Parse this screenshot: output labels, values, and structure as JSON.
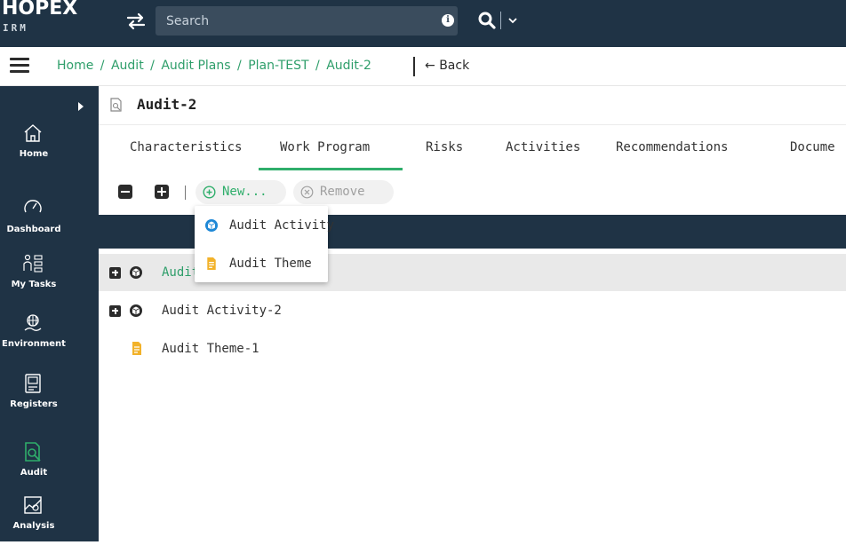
{
  "app": {
    "logo": "HOPEX",
    "logo_sub": "IRM"
  },
  "header": {
    "search_placeholder": "Search"
  },
  "breadcrumb": {
    "items": [
      "Home",
      "Audit",
      "Audit Plans",
      "Plan-TEST",
      "Audit-2"
    ],
    "separator": "/",
    "back_label": "Back"
  },
  "sidebar": {
    "items": [
      {
        "label": "Home",
        "icon": "home-icon"
      },
      {
        "label": "Dashboard",
        "icon": "dashboard-icon"
      },
      {
        "label": "My Tasks",
        "icon": "tasks-icon"
      },
      {
        "label": "Environment",
        "icon": "environment-icon"
      },
      {
        "label": "Registers",
        "icon": "registers-icon"
      },
      {
        "label": "Audit",
        "icon": "audit-icon",
        "active": true
      },
      {
        "label": "Analysis",
        "icon": "analysis-icon"
      }
    ]
  },
  "object": {
    "title": "Audit-2"
  },
  "tabs": [
    {
      "label": "Characteristics"
    },
    {
      "label": "Work Program",
      "active": true
    },
    {
      "label": "Risks"
    },
    {
      "label": "Activities"
    },
    {
      "label": "Recommendations"
    },
    {
      "label": "Docume"
    }
  ],
  "toolbar": {
    "new_label": "New...",
    "remove_label": "Remove"
  },
  "rows": [
    {
      "label": "Audit",
      "type": "activity",
      "selected": true
    },
    {
      "label": "Audit Activity-2",
      "type": "activity"
    },
    {
      "label": "Audit Theme-1",
      "type": "theme"
    }
  ],
  "new_menu": {
    "items": [
      {
        "label": "Audit Activity",
        "icon": "audit-activity-icon"
      },
      {
        "label": "Audit Theme",
        "icon": "audit-theme-icon"
      }
    ]
  },
  "colors": {
    "header_bg": "#1f3345",
    "accent_green": "#2fae6b",
    "link_green": "#2e9e6a",
    "activity_blue": "#1e88d6",
    "theme_yellow": "#f2b22a"
  }
}
